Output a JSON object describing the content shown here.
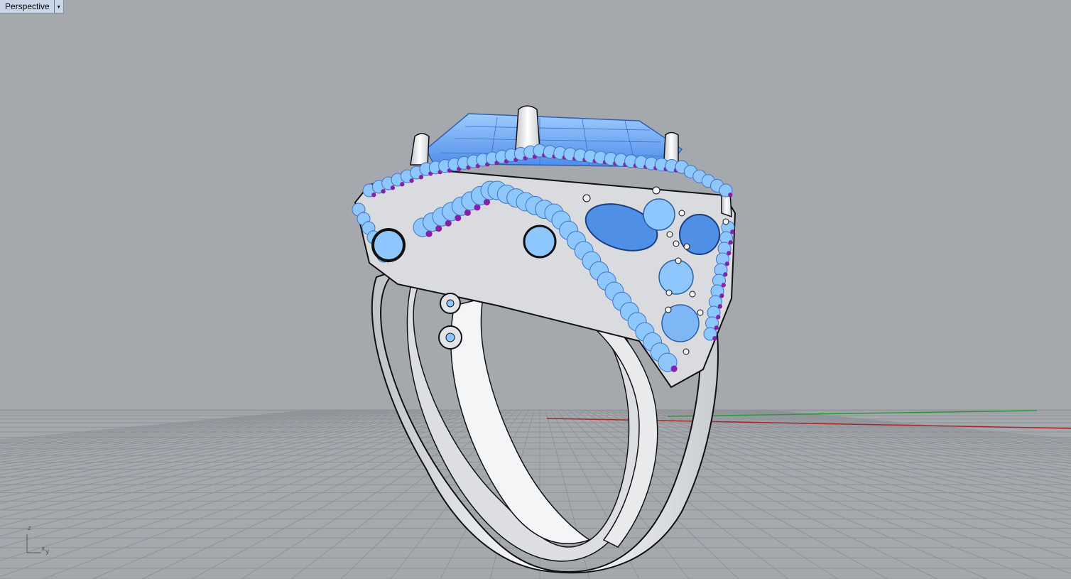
{
  "viewport": {
    "title": "Perspective",
    "menu_arrow": "▾",
    "background_color": "#a5a9ae",
    "grid_color": "#8e9297",
    "x_axis_color": "#b02020",
    "y_axis_color": "#22a030"
  },
  "axis_widget": {
    "z_label": "z",
    "x_label": "x",
    "y_label": "y"
  },
  "model": {
    "metal_color": "#e6e7e9",
    "gem_light_color": "#8ec6ff",
    "gem_dark_color": "#3e7fe0",
    "accent_color": "#8a1ea8"
  }
}
